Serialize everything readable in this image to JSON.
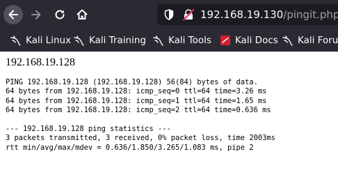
{
  "toolbar": {
    "back_icon": "arrow-left-icon",
    "forward_icon": "arrow-right-icon",
    "reload_icon": "reload-icon",
    "home_icon": "home-icon"
  },
  "address_bar": {
    "host": "192.168.19.130",
    "path": "/pingit.php",
    "shield_icon": "shield-icon",
    "insecure_icon": "insecure-lock-icon"
  },
  "bookmarks": [
    {
      "label": "Kali Linux",
      "icon": "kali-dragon-icon"
    },
    {
      "label": "Kali Training",
      "icon": "kali-dragon-icon"
    },
    {
      "label": "Kali Tools",
      "icon": "kali-dragon-icon"
    },
    {
      "label": "Kali Docs",
      "icon": "kali-docs-icon"
    },
    {
      "label": "Kali Forums",
      "icon": "kali-dragon-icon"
    }
  ],
  "page": {
    "title": "192.168.19.128",
    "output_lines": [
      "PING 192.168.19.128 (192.168.19.128) 56(84) bytes of data.",
      "64 bytes from 192.168.19.128: icmp_seq=0 ttl=64 time=3.26 ms",
      "64 bytes from 192.168.19.128: icmp_seq=1 ttl=64 time=1.65 ms",
      "64 bytes from 192.168.19.128: icmp_seq=2 ttl=64 time=0.636 ms",
      "",
      "--- 192.168.19.128 ping statistics ---",
      "3 packets transmitted, 3 received, 0% packet loss, time 2003ms",
      "rtt min/avg/max/mdev = 0.636/1.850/3.265/1.083 ms, pipe 2"
    ]
  },
  "colors": {
    "chrome_bg": "#2b2a33",
    "urlbar_bg": "#1c1b22",
    "insecure_red": "#e22850"
  }
}
